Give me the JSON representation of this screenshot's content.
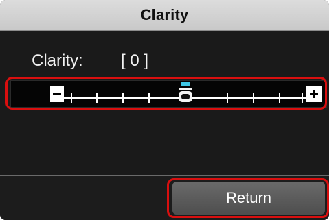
{
  "window": {
    "title": "Clarity"
  },
  "setting": {
    "label": "Clarity:",
    "value_display": "[ 0 ]",
    "value": 0
  },
  "slider": {
    "min_steps": -4,
    "max_steps": 4,
    "current": 0,
    "decrease_icon": "minus-icon",
    "increase_icon": "plus-icon",
    "thumb_icon": "slider-thumb-icon",
    "accent_color": "#3ec7e6"
  },
  "footer": {
    "return_label": "Return"
  },
  "highlight_color": "#d90f0f"
}
